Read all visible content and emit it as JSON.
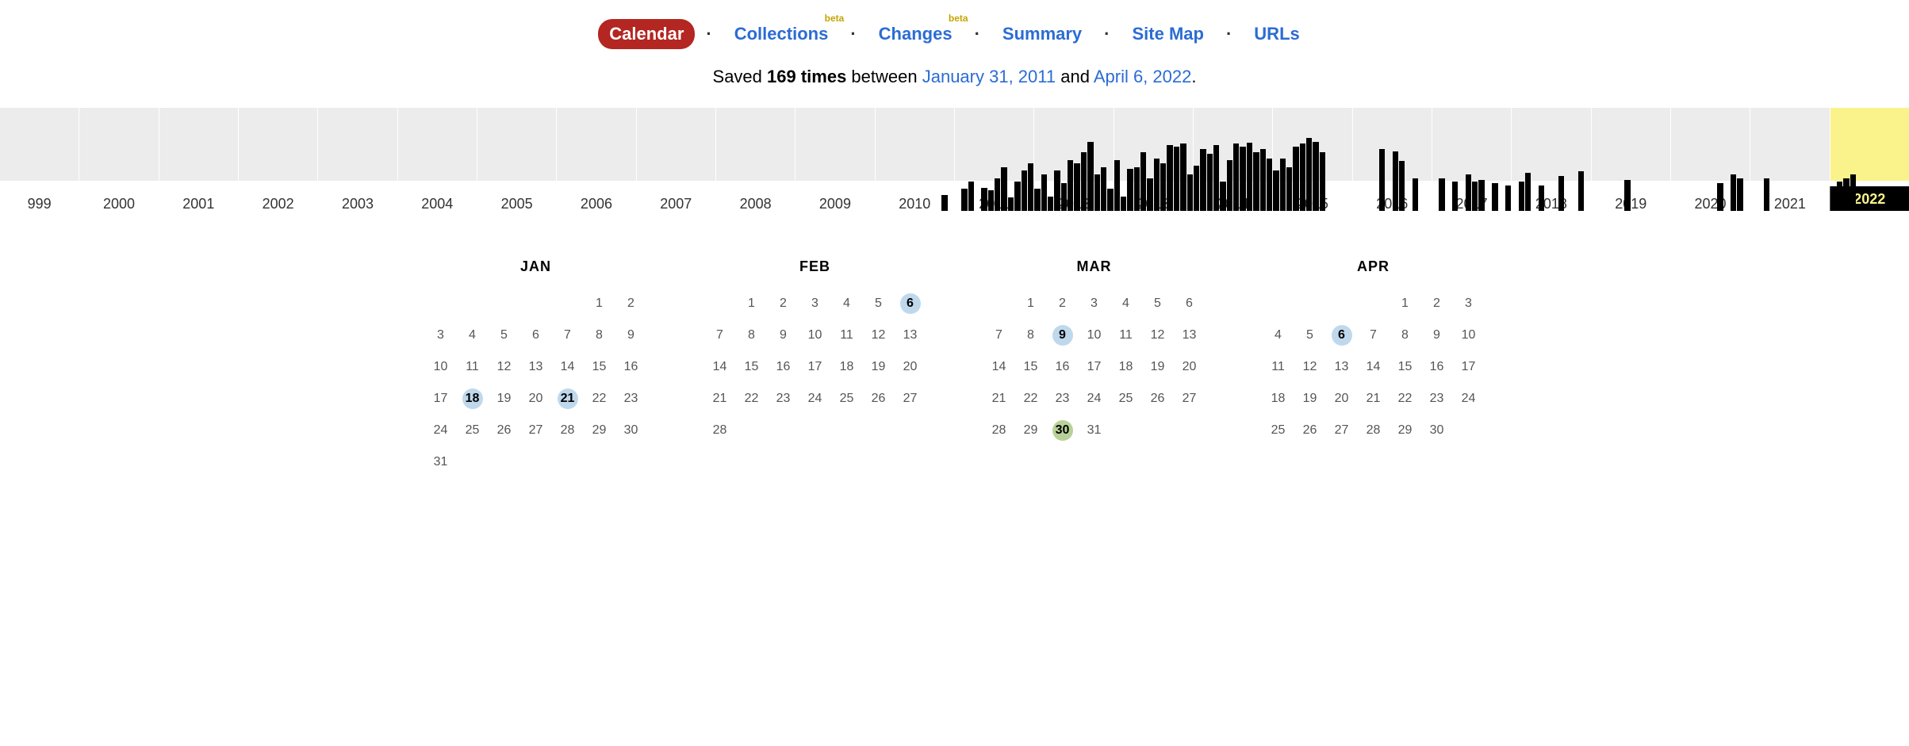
{
  "nav": {
    "items": [
      {
        "label": "Calendar",
        "active": true,
        "beta": false
      },
      {
        "label": "Collections",
        "active": false,
        "beta": true
      },
      {
        "label": "Changes",
        "active": false,
        "beta": true
      },
      {
        "label": "Summary",
        "active": false,
        "beta": false
      },
      {
        "label": "Site Map",
        "active": false,
        "beta": false
      },
      {
        "label": "URLs",
        "active": false,
        "beta": false
      }
    ],
    "beta_label": "beta"
  },
  "summary": {
    "prefix": "Saved ",
    "count": "169 times",
    "between": " between ",
    "start_date": "January 31, 2011",
    "and": " and ",
    "end_date": "April 6, 2022",
    "suffix": "."
  },
  "timeline": {
    "selected_year": "2022",
    "years": [
      {
        "label": "999",
        "bars": []
      },
      {
        "label": "2000",
        "bars": []
      },
      {
        "label": "2001",
        "bars": []
      },
      {
        "label": "2002",
        "bars": []
      },
      {
        "label": "2003",
        "bars": []
      },
      {
        "label": "2004",
        "bars": []
      },
      {
        "label": "2005",
        "bars": []
      },
      {
        "label": "2006",
        "bars": []
      },
      {
        "label": "2007",
        "bars": []
      },
      {
        "label": "2008",
        "bars": []
      },
      {
        "label": "2009",
        "bars": []
      },
      {
        "label": "2010",
        "bars": [
          0,
          0,
          0,
          0,
          0,
          0,
          0,
          0,
          0,
          0,
          22,
          0
        ]
      },
      {
        "label": "2011",
        "bars": [
          0,
          30,
          40,
          0,
          32,
          28,
          45,
          60,
          18,
          40,
          55,
          65
        ]
      },
      {
        "label": "2012",
        "bars": [
          30,
          50,
          20,
          55,
          38,
          70,
          65,
          80,
          95,
          50,
          60,
          30
        ]
      },
      {
        "label": "2013",
        "bars": [
          70,
          20,
          58,
          60,
          80,
          45,
          72,
          65,
          90,
          88,
          92,
          50
        ]
      },
      {
        "label": "2014",
        "bars": [
          62,
          85,
          78,
          90,
          40,
          70,
          92,
          88,
          94,
          80,
          85,
          72
        ]
      },
      {
        "label": "2015",
        "bars": [
          55,
          72,
          60,
          88,
          92,
          100,
          95,
          80,
          0,
          0,
          0,
          0
        ]
      },
      {
        "label": "2016",
        "bars": [
          0,
          0,
          0,
          0,
          85,
          0,
          82,
          68,
          0,
          45,
          0,
          0
        ]
      },
      {
        "label": "2017",
        "bars": [
          0,
          45,
          0,
          40,
          0,
          50,
          40,
          42,
          0,
          38,
          0,
          35
        ]
      },
      {
        "label": "2018",
        "bars": [
          0,
          40,
          52,
          0,
          35,
          0,
          0,
          48,
          0,
          0,
          54,
          0
        ]
      },
      {
        "label": "2019",
        "bars": [
          0,
          0,
          0,
          0,
          0,
          42,
          0,
          0,
          0,
          0,
          0,
          0
        ]
      },
      {
        "label": "2020",
        "bars": [
          0,
          0,
          0,
          0,
          0,
          0,
          0,
          38,
          0,
          50,
          45,
          0
        ]
      },
      {
        "label": "2021",
        "bars": [
          0,
          0,
          45,
          0,
          0,
          0,
          0,
          0,
          0,
          0,
          0,
          0
        ]
      },
      {
        "label": "2022",
        "bars": [
          0,
          40,
          45,
          50,
          0,
          0,
          0,
          0,
          0,
          0,
          0,
          0
        ]
      }
    ]
  },
  "months": [
    {
      "name": "JAN",
      "offset": 5,
      "days": 31,
      "snapshots": {
        "18": "blue",
        "21": "blue"
      }
    },
    {
      "name": "FEB",
      "offset": 1,
      "days": 28,
      "snapshots": {
        "6": "blue"
      }
    },
    {
      "name": "MAR",
      "offset": 1,
      "days": 31,
      "snapshots": {
        "9": "blue",
        "30": "green"
      }
    },
    {
      "name": "APR",
      "offset": 4,
      "days": 30,
      "snapshots": {
        "6": "blue"
      }
    }
  ]
}
